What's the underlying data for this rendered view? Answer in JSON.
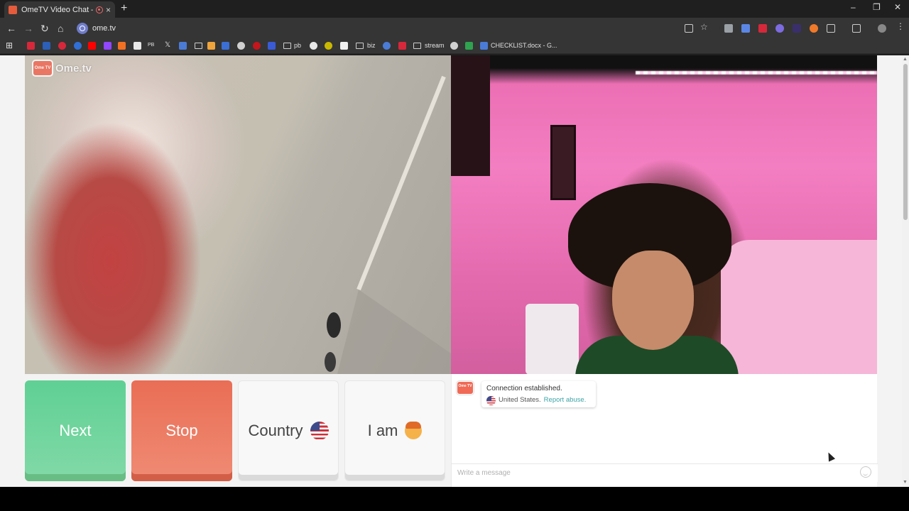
{
  "browser": {
    "tab_title": "OmeTV Video Chat — Om",
    "tab_close": "×",
    "new_tab": "+",
    "window_controls": {
      "minimize": "–",
      "maximize": "❐",
      "close": "✕"
    },
    "url": "ome.tv",
    "nav": {
      "back": "←",
      "forward": "→",
      "reload": "↻",
      "home": "⌂"
    },
    "bookmarks": [
      {
        "label": "pb",
        "icon": "folder-icon"
      },
      {
        "label": "biz",
        "icon": "folder-icon"
      },
      {
        "label": "stream",
        "icon": "folder-icon"
      },
      {
        "label": "CHECKLIST.docx - G...",
        "icon": "docs-icon"
      }
    ],
    "bookmark_glyphs": {
      "grid": "⊞",
      "pb_badge": "PB",
      "x": "𝕏"
    }
  },
  "site": {
    "logo_badge": "Ome TV",
    "logo_text": "Ome.tv"
  },
  "controls": {
    "next_label": "Next",
    "stop_label": "Stop",
    "country_label": "Country",
    "iam_label": "I am"
  },
  "chat": {
    "avatar_badge": "Ome TV",
    "system_message": "Connection established.",
    "country": "United States.",
    "report_link": "Report abuse.",
    "input_placeholder": "Write a message"
  },
  "colors": {
    "next": "#6fd29a",
    "stop": "#ec7a63",
    "accent_link": "#3fa3a6"
  }
}
